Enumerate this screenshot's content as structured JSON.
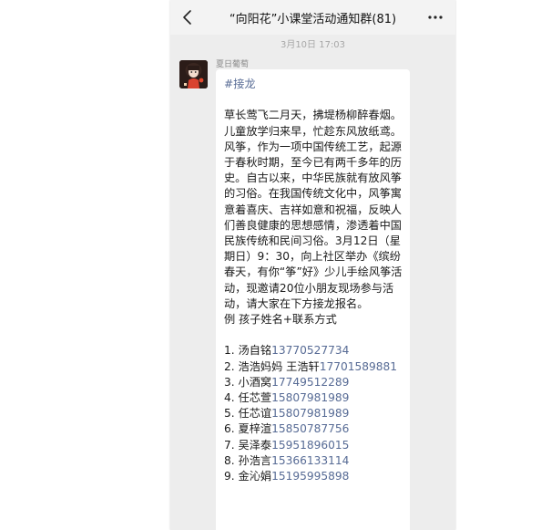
{
  "chat": {
    "title": "“向阳花”小课堂活动通知群(81)",
    "timestamp": "3月10日 17:03"
  },
  "message": {
    "sender": "夏日葡萄",
    "topic": "#接龙",
    "lines": [
      "草长莺飞二月天，拂堤杨柳醉春烟。",
      "儿童放学归来早，忙趁东风放纸鸢。",
      "风筝，作为一项中国传统工艺，起源于春秋时期，至今已有两千多年的历史。自古以来，中华民族就有放风筝的习俗。在我国传统文化中，风筝寓意着喜庆、吉祥如意和祝福，反映人们善良健康的思想感情，渗透着中国民族传统和民间习俗。3月12日（星期日）9：30，向上社区举办《缤纷春天，有你“筝”好》少儿手绘风筝活动，现邀请20位小朋友现场参与活动，请大家在下方接龙报名。",
      "例 孩子姓名+联系方式"
    ],
    "entries": [
      {
        "prefix": "1. 汤自铭",
        "phone": "13770527734"
      },
      {
        "prefix": "2. 浩浩妈妈 王浩轩",
        "phone": "17701589881"
      },
      {
        "prefix": "3. 小酒窝",
        "phone": "17749512289"
      },
      {
        "prefix": "4. 任芯萱",
        "phone": "15807981989"
      },
      {
        "prefix": "5. 任芯谊",
        "phone": "15807981989"
      },
      {
        "prefix": "6. 夏梓渲",
        "phone": "15850787756"
      },
      {
        "prefix": "7. 吴泽泰",
        "phone": "15951896015"
      },
      {
        "prefix": "8. 孙浩言",
        "phone": "15366133114"
      },
      {
        "prefix": "9. 金沁娟",
        "phone": "15195995898"
      }
    ]
  },
  "icons": {
    "back": "chevron-left-icon",
    "more": "more-dots-icon"
  },
  "colors": {
    "link": "#576b95",
    "chat_background": "#ededed",
    "bubble": "#ffffff"
  }
}
